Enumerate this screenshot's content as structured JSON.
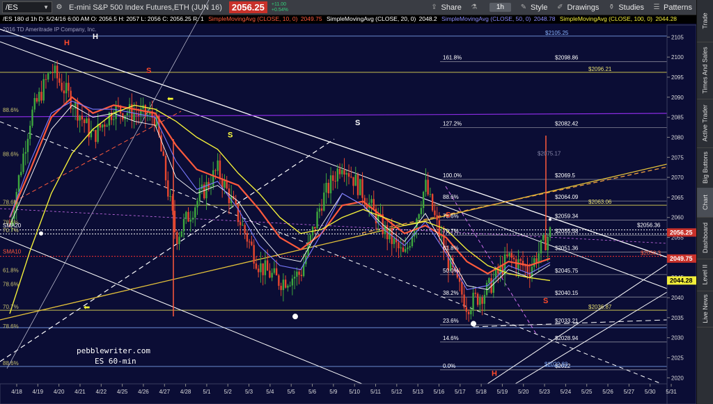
{
  "toolbar": {
    "symbol": "/ES",
    "description": "E-mini S&P 500 Index Futures,ETH (JUN 16)",
    "last_price": "2056.25",
    "change": "+11.00",
    "change_pct": "+0.54%",
    "share_label": "Share",
    "timeframe": "1h",
    "style_label": "Style",
    "drawings_label": "Drawings",
    "studies_label": "Studies",
    "patterns_label": "Patterns"
  },
  "sidebar": {
    "tabs": [
      "Trade",
      "Times And Sales",
      "Active Trader",
      "Big Buttons",
      "Chart",
      "Dashboard",
      "Level II",
      "Live News"
    ]
  },
  "infobar": {
    "ohlc": "/ES 180 d 1h  D: 5/24/16 6:00 AM  O: 2056.5  H: 2057  L: 2056  C: 2056.25  R: 1",
    "sma10": "SimpleMovingAvg (CLOSE, 10, 0)",
    "sma10_val": "2049.75",
    "sma20": "SimpleMovingAvg (CLOSE, 20, 0)",
    "sma20_val": "2048.2",
    "sma50": "SimpleMovingAvg (CLOSE, 50, 0)",
    "sma50_val": "2048.78",
    "sma100": "SimpleMovingAvg (CLOSE, 100, 0)",
    "sma100_val": "2044.28"
  },
  "copyright": "2016 TD Ameritrade IP Company, Inc.",
  "watermark": [
    "pebblewriter.com",
    "ES 60-min"
  ],
  "colors": {
    "background": "#0b0d35",
    "sma10": "#ff5a3c",
    "sma20": "#ffffff",
    "sma50": "#7a7aff",
    "sma100": "#f2ee3a",
    "fib": "#e8e070",
    "up_candle": "#3ea83e",
    "down_candle": "#e8462e"
  },
  "chart_data": {
    "type": "line",
    "title": "",
    "xlabel": "",
    "ylabel": "",
    "ylim": [
      2018.5,
      2108
    ],
    "x_ticks": [
      "4/18",
      "4/19",
      "4/20",
      "4/21",
      "4/22",
      "4/25",
      "4/26",
      "4/27",
      "4/28",
      "5/1",
      "5/2",
      "5/3",
      "5/4",
      "5/5",
      "5/6",
      "5/9",
      "5/10",
      "5/11",
      "5/12",
      "5/13",
      "5/16",
      "5/17",
      "5/18",
      "5/19",
      "5/20",
      "5/23",
      "5/24",
      "5/25",
      "5/26",
      "5/27",
      "5/30",
      "5/31"
    ],
    "y_ticks": [
      2020,
      2025,
      2030,
      2035,
      2040,
      2045,
      2050,
      2055,
      2060,
      2065,
      2070,
      2075,
      2080,
      2085,
      2090,
      2095,
      2100,
      2105
    ],
    "series": [
      {
        "name": "",
        "values": [
          2058,
          2085,
          2097,
          2089,
          2080,
          2087,
          2086,
          2085,
          2055,
          2064,
          2072,
          2060,
          2048,
          2044,
          2046,
          2064,
          2074,
          2066,
          2057,
          2050,
          2068,
          2050,
          2038,
          2042,
          2050,
          2047,
          2056.25
        ]
      },
      {
        "name": "SimpleMovingAvg (CLOSE, 10, 0)",
        "values": [
          2060,
          2072,
          2085,
          2090,
          2086,
          2088,
          2087,
          2086,
          2078,
          2072,
          2070,
          2068,
          2062,
          2055,
          2052,
          2056,
          2063,
          2064,
          2060,
          2056,
          2058,
          2055,
          2049,
          2046,
          2049,
          2048,
          2049.75
        ]
      },
      {
        "name": "SimpleMovingAvg (CLOSE, 20, 0)",
        "values": [
          2058,
          2070,
          2082,
          2088,
          2085,
          2086,
          2084,
          2083,
          2070,
          2066,
          2068,
          2064,
          2056,
          2050,
          2049,
          2058,
          2066,
          2063,
          2058,
          2054,
          2061,
          2052,
          2043,
          2042,
          2047,
          2045,
          2048.2
        ]
      },
      {
        "name": "SimpleMovingAvg (CLOSE, 50, 0)",
        "values": [
          2060,
          2074,
          2086,
          2089,
          2087,
          2087,
          2086,
          2085,
          2074,
          2067,
          2069,
          2062,
          2053,
          2048,
          2047,
          2056,
          2066,
          2063,
          2057,
          2053,
          2059,
          2051,
          2042,
          2043,
          2048,
          2046,
          2048.78
        ]
      },
      {
        "name": "SimpleMovingAvg (CLOSE, 100, 0)",
        "values": [
          2036,
          2052,
          2066,
          2076,
          2082,
          2086,
          2088,
          2087,
          2084,
          2080,
          2077,
          2071,
          2066,
          2060,
          2056,
          2057,
          2060,
          2062,
          2060,
          2058,
          2059,
          2057,
          2052,
          2048,
          2046,
          2045,
          2044.28
        ]
      }
    ],
    "fib_labels": [
      {
        "pct": "161.8%",
        "value": "$2098.86"
      },
      {
        "pct": "127.2%",
        "value": "$2082.42"
      },
      {
        "pct": "100.0%",
        "value": "$2069.5"
      },
      {
        "pct": "88.6%",
        "value": "$2064.09"
      },
      {
        "pct": "78.6%",
        "value": "$2059.34"
      },
      {
        "pct": "70.7%",
        "value": "$2055.58"
      },
      {
        "pct": "61.8%",
        "value": "$2051.36"
      },
      {
        "pct": "50.0%",
        "value": "$2045.75"
      },
      {
        "pct": "38.2%",
        "value": "$2040.15"
      },
      {
        "pct": "23.6%",
        "value": "$2033.21"
      },
      {
        "pct": "14.6%",
        "value": "$2028.94"
      },
      {
        "pct": "0.0%",
        "value": "$2022"
      }
    ],
    "level_labels": [
      {
        "value": "$2105.25",
        "color": "#8ab4ff"
      },
      {
        "value": "$2096.21",
        "color": "#e8e070"
      },
      {
        "value": "$2063.06",
        "color": "#e8e070"
      },
      {
        "value": "$2036.87",
        "color": "#e8e070"
      },
      {
        "value": "$2056.36",
        "color": "#ffffff"
      },
      {
        "value": "$2075.17",
        "color": "#8888aa"
      },
      {
        "value": "$2050.3",
        "color": "#ff5a3c"
      },
      {
        "value": "$2022.83",
        "color": "#8ab4ff"
      }
    ],
    "left_fib_labels": [
      "88.6%",
      "88.6%",
      "78.6%",
      "78.6%",
      "70.7%",
      "61.8%",
      "78.6%",
      "70.7%",
      "78.6%",
      "88.6%"
    ],
    "pattern_labels": [
      "H",
      "S",
      "S",
      "S",
      "S",
      "S",
      "H"
    ],
    "left_labels": [
      "SMA20",
      "SMA10"
    ],
    "price_tags": [
      {
        "value": "2056.25",
        "color": "#c8312a",
        "text_color": "#ffffff"
      },
      {
        "value": "2049.75",
        "color": "#c8312a",
        "text_color": "#ffffff"
      },
      {
        "value": "2044.28",
        "color": "#f2ee3a",
        "text_color": "#000000"
      }
    ]
  }
}
